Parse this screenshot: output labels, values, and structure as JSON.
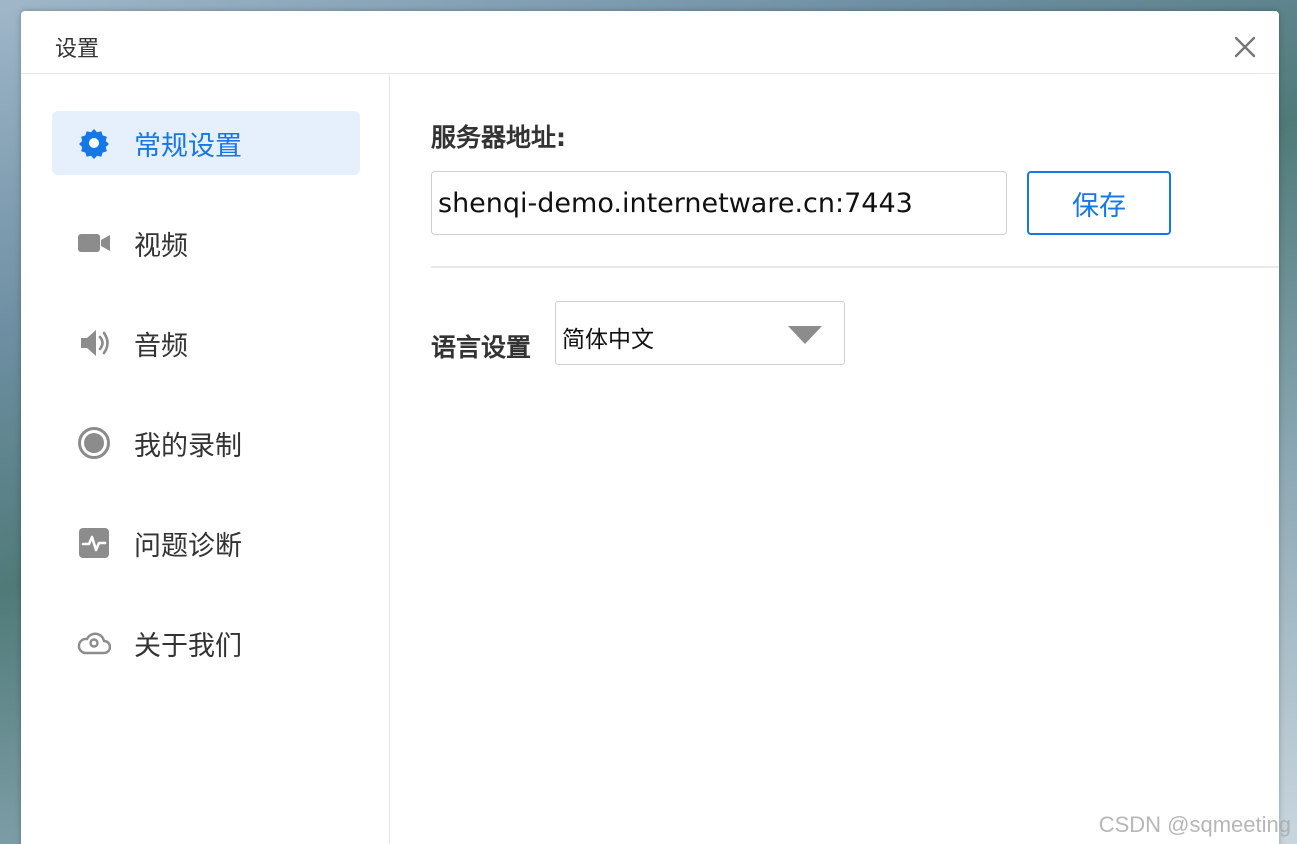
{
  "dialog": {
    "title": "设置"
  },
  "sidebar": {
    "items": [
      {
        "label": "常规设置",
        "icon": "gear-icon",
        "active": true
      },
      {
        "label": "视频",
        "icon": "video-camera-icon",
        "active": false
      },
      {
        "label": "音频",
        "icon": "speaker-icon",
        "active": false
      },
      {
        "label": "我的录制",
        "icon": "record-icon",
        "active": false
      },
      {
        "label": "问题诊断",
        "icon": "pulse-icon",
        "active": false
      },
      {
        "label": "关于我们",
        "icon": "cloud-icon",
        "active": false
      }
    ]
  },
  "general": {
    "server_label": "服务器地址:",
    "server_value": "shenqi-demo.internetware.cn:7443",
    "save_label": "保存",
    "language_label": "语言设置",
    "language_value": "简体中文"
  },
  "watermark": "CSDN @sqmeeting",
  "colors": {
    "accent": "#1677e6",
    "active_bg": "#e6f0fd",
    "icon_gray": "#8c8c8c"
  }
}
